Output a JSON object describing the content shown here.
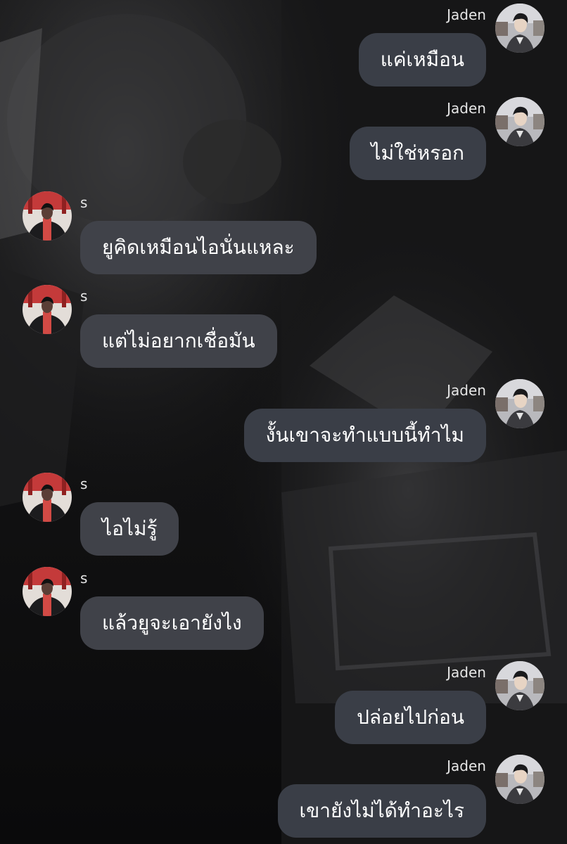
{
  "chat": {
    "messages": [
      {
        "side": "right",
        "sender": "Jaden",
        "text": "แค่เหมือน"
      },
      {
        "side": "right",
        "sender": "Jaden",
        "text": "ไม่ใช่หรอก"
      },
      {
        "side": "left",
        "sender": "s",
        "text": "ยูคิดเหมือนไอนั่นแหละ"
      },
      {
        "side": "left",
        "sender": "s",
        "text": "แต่ไม่อยากเชื่อมัน"
      },
      {
        "side": "right",
        "sender": "Jaden",
        "text": "งั้นเขาจะทำแบบนี้ทำไม"
      },
      {
        "side": "left",
        "sender": "s",
        "text": "ไอไม่รู้"
      },
      {
        "side": "left",
        "sender": "s",
        "text": "แล้วยูจะเอายังไง"
      },
      {
        "side": "right",
        "sender": "Jaden",
        "text": "ปล่อยไปก่อน"
      },
      {
        "side": "right",
        "sender": "Jaden",
        "text": "เขายังไม่ได้ทำอะไร"
      }
    ]
  },
  "colors": {
    "bubble_right": "#3a3e47",
    "bubble_left": "#404249",
    "sender_text": "#e6e6e6",
    "message_text": "#ffffff"
  },
  "icons": {
    "jaden_avatar": "jaden-avatar-photo",
    "s_avatar": "s-avatar-photo"
  }
}
